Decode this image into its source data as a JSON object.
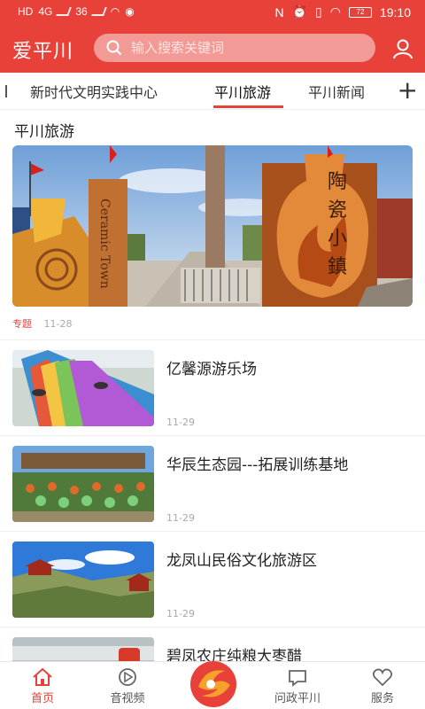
{
  "status": {
    "left": [
      "HD",
      "4G",
      "36"
    ],
    "time": "19:10",
    "battery": "72"
  },
  "header": {
    "app_title": "爱平川",
    "search_placeholder": "输入搜索关键词",
    "icons": [
      "search-icon",
      "user-icon"
    ]
  },
  "tabs": [
    {
      "label": "新时代文明实践中心",
      "active": false
    },
    {
      "label": "平川旅游",
      "active": true
    },
    {
      "label": "平川新闻",
      "active": false
    }
  ],
  "tab_add_label": "+",
  "section_title": "平川旅游",
  "featured": {
    "sign_left": "Ceramic Town",
    "sign_right": "陶瓷小鎮",
    "tag": "专题",
    "date": "11-28"
  },
  "news": [
    {
      "title": "亿馨源游乐场",
      "date": "11-29"
    },
    {
      "title": "华辰生态园---拓展训练基地",
      "date": "11-29"
    },
    {
      "title": "龙凤山民俗文化旅游区",
      "date": "11-29"
    },
    {
      "title": "碧凤农庄纯粮大枣醋",
      "date": ""
    }
  ],
  "bottom_nav": [
    {
      "label": "首页",
      "icon": "home-icon",
      "active": true
    },
    {
      "label": "音视频",
      "icon": "video-icon",
      "active": false
    },
    {
      "label": "",
      "icon": "logo-icon",
      "active": false
    },
    {
      "label": "问政平川",
      "icon": "message-icon",
      "active": false
    },
    {
      "label": "服务",
      "icon": "heart-icon",
      "active": false
    }
  ],
  "colors": {
    "accent": "#e8413a",
    "text": "#222222",
    "muted": "#aaaaaa"
  }
}
